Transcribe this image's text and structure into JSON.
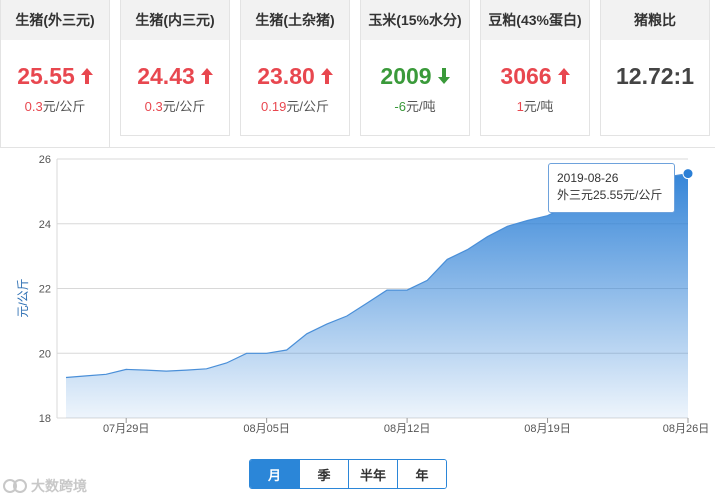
{
  "cards": [
    {
      "title": "生猪(外三元)",
      "price": "25.55",
      "change_value": "0.3",
      "change_unit": "元/公斤",
      "trend": "up"
    },
    {
      "title": "生猪(内三元)",
      "price": "24.43",
      "change_value": "0.3",
      "change_unit": "元/公斤",
      "trend": "up"
    },
    {
      "title": "生猪(土杂猪)",
      "price": "23.80",
      "change_value": "0.19",
      "change_unit": "元/公斤",
      "trend": "up"
    },
    {
      "title": "玉米(15%水分)",
      "price": "2009",
      "change_value": "-6",
      "change_unit": "元/吨",
      "trend": "down"
    },
    {
      "title": "豆粕(43%蛋白)",
      "price": "3066",
      "change_value": "1",
      "change_unit": "元/吨",
      "trend": "up"
    },
    {
      "title": "猪粮比",
      "price": "12.72:1",
      "change_value": "",
      "change_unit": "",
      "trend": "none"
    }
  ],
  "colors": {
    "up": "#e8474f",
    "down": "#3a9a3a",
    "accent": "#2b86d8"
  },
  "chart_data": {
    "type": "area",
    "ylabel": "元/公斤",
    "ylim": [
      18,
      26
    ],
    "yticks": [
      18,
      20,
      22,
      24,
      26
    ],
    "xticks": [
      "07月29日",
      "08月05日",
      "08月12日",
      "08月19日",
      "08月26日"
    ],
    "dates": [
      "2019-07-26",
      "2019-07-27",
      "2019-07-28",
      "2019-07-29",
      "2019-07-30",
      "2019-07-31",
      "2019-08-01",
      "2019-08-02",
      "2019-08-03",
      "2019-08-04",
      "2019-08-05",
      "2019-08-06",
      "2019-08-07",
      "2019-08-08",
      "2019-08-09",
      "2019-08-10",
      "2019-08-11",
      "2019-08-12",
      "2019-08-13",
      "2019-08-14",
      "2019-08-15",
      "2019-08-16",
      "2019-08-17",
      "2019-08-18",
      "2019-08-19",
      "2019-08-20",
      "2019-08-21",
      "2019-08-22",
      "2019-08-23",
      "2019-08-24",
      "2019-08-25",
      "2019-08-26"
    ],
    "values": [
      19.25,
      19.3,
      19.35,
      19.5,
      19.48,
      19.45,
      19.48,
      19.52,
      19.7,
      20.0,
      20.0,
      20.1,
      20.6,
      20.9,
      21.15,
      21.55,
      21.95,
      21.95,
      22.25,
      22.9,
      23.2,
      23.6,
      23.92,
      24.1,
      24.25,
      24.55,
      24.9,
      25.1,
      25.25,
      25.35,
      25.45,
      25.55
    ],
    "grid": true
  },
  "tooltip": {
    "date": "2019-08-26",
    "label": "外三元25.55元/公斤"
  },
  "periods": [
    {
      "label": "月",
      "active": true
    },
    {
      "label": "季",
      "active": false
    },
    {
      "label": "半年",
      "active": false
    },
    {
      "label": "年",
      "active": false
    }
  ],
  "watermark": "大数跨境"
}
